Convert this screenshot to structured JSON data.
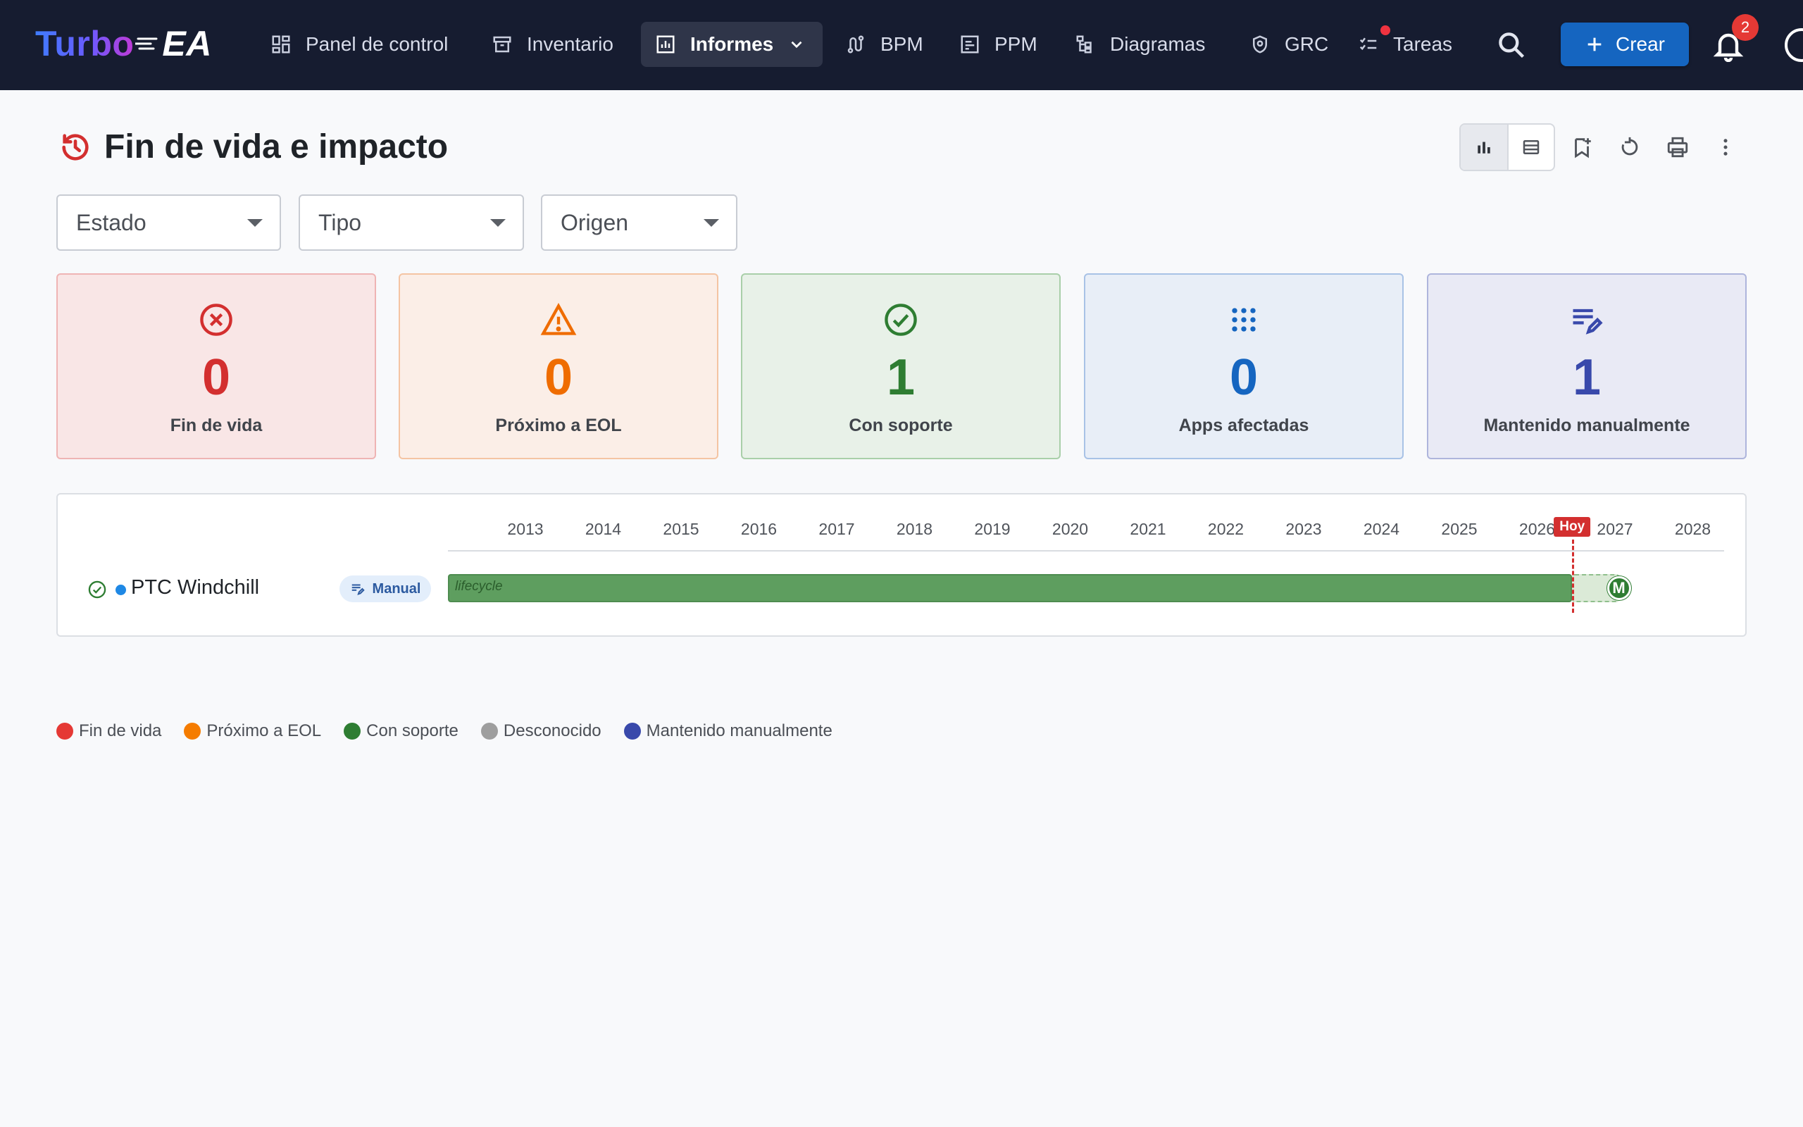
{
  "app": {
    "logo_part1": "Turbo",
    "logo_part2": "EA"
  },
  "nav": {
    "items": [
      {
        "label": "Panel de control",
        "icon": "dashboard-icon"
      },
      {
        "label": "Inventario",
        "icon": "archive-icon"
      },
      {
        "label": "Informes",
        "icon": "report-icon",
        "active": true,
        "has_dropdown": true
      },
      {
        "label": "BPM",
        "icon": "route-icon"
      },
      {
        "label": "PPM",
        "icon": "project-icon"
      },
      {
        "label": "Diagramas",
        "icon": "diagram-icon"
      },
      {
        "label": "GRC",
        "icon": "shield-icon"
      },
      {
        "label": "Tareas",
        "icon": "checklist-icon",
        "has_dot": true
      }
    ],
    "create_label": "Crear",
    "notification_count": "2"
  },
  "page": {
    "title": "Fin de vida e impacto",
    "title_icon": "history-icon"
  },
  "filters": {
    "estado": "Estado",
    "tipo": "Tipo",
    "origen": "Origen"
  },
  "kpis": [
    {
      "value": "0",
      "label": "Fin de vida",
      "icon": "cancel-circle-icon",
      "color": "#d32f2f",
      "bg": "#f9e6e6",
      "border": "#efb4b4"
    },
    {
      "value": "0",
      "label": "Próximo a EOL",
      "icon": "warning-icon",
      "color": "#ef6c00",
      "bg": "#fbeee7",
      "border": "#f4c4a3"
    },
    {
      "value": "1",
      "label": "Con soporte",
      "icon": "check-circle-icon",
      "color": "#2e7d32",
      "bg": "#e8f1e8",
      "border": "#a9cfa9"
    },
    {
      "value": "0",
      "label": "Apps afectadas",
      "icon": "apps-grid-icon",
      "color": "#1565c0",
      "bg": "#e8eef7",
      "border": "#a8c2e6"
    },
    {
      "value": "1",
      "label": "Mantenido manualmente",
      "icon": "edit-note-icon",
      "color": "#3949ab",
      "bg": "#e9eaf5",
      "border": "#aeb5dc"
    }
  ],
  "timeline": {
    "years": [
      "2013",
      "2014",
      "2015",
      "2016",
      "2017",
      "2018",
      "2019",
      "2020",
      "2021",
      "2022",
      "2023",
      "2024",
      "2025",
      "2026",
      "2027",
      "2028"
    ],
    "today_label": "Hoy",
    "today_year_fraction": 2026.45,
    "rows": [
      {
        "name": "PTC Windchill",
        "chip": "Manual",
        "bar_label": "lifecycle",
        "bar_start": 2012.0,
        "active_end": 2026.45,
        "end": 2027.05,
        "milestone": "M",
        "status": "Con soporte"
      }
    ]
  },
  "legend": [
    {
      "label": "Fin de vida",
      "color": "#e53935"
    },
    {
      "label": "Próximo a EOL",
      "color": "#f57c00"
    },
    {
      "label": "Con soporte",
      "color": "#2e7d32"
    },
    {
      "label": "Desconocido",
      "color": "#9e9e9e"
    },
    {
      "label": "Mantenido manualmente",
      "color": "#3949ab"
    }
  ]
}
